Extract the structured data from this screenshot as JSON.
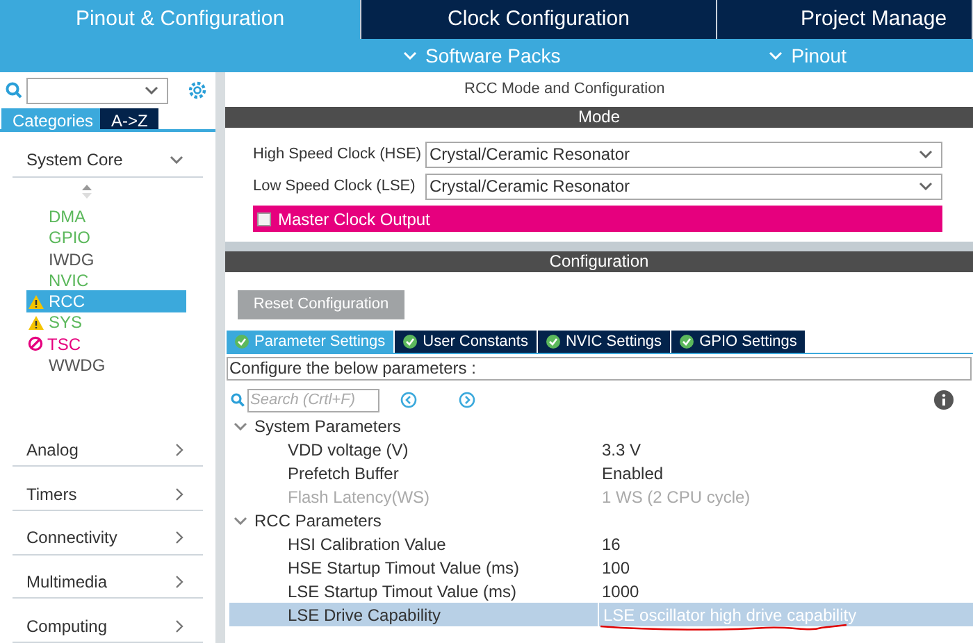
{
  "top_tabs": [
    {
      "label": "Pinout & Configuration",
      "selected": true
    },
    {
      "label": "Clock Configuration",
      "selected": false
    },
    {
      "label": "Project Manage",
      "selected": false
    }
  ],
  "sub_menu": [
    "Software Packs",
    "Pinout"
  ],
  "sidebar": {
    "view_tabs": [
      {
        "label": "Categories",
        "selected": true
      },
      {
        "label": "A->Z",
        "selected": false
      }
    ],
    "groups": [
      {
        "label": "System Core",
        "expanded": true,
        "items": [
          {
            "label": "DMA",
            "color": "#5cb85c",
            "kind": "ok",
            "selected": false
          },
          {
            "label": "GPIO",
            "color": "#5cb85c",
            "kind": "ok",
            "selected": false
          },
          {
            "label": "IWDG",
            "color": "#555555",
            "kind": "ok",
            "selected": false
          },
          {
            "label": "NVIC",
            "color": "#5cb85c",
            "kind": "ok",
            "selected": false
          },
          {
            "label": "RCC",
            "kind": "warning",
            "selected": true
          },
          {
            "label": "SYS",
            "color": "#5cb85c",
            "kind": "warning",
            "selected": false
          },
          {
            "label": "TSC",
            "color": "#e6007e",
            "kind": "error",
            "selected": false
          },
          {
            "label": "WWDG",
            "color": "#555555",
            "kind": "ok",
            "selected": false
          }
        ]
      },
      {
        "label": "Analog",
        "expanded": false
      },
      {
        "label": "Timers",
        "expanded": false
      },
      {
        "label": "Connectivity",
        "expanded": false
      },
      {
        "label": "Multimedia",
        "expanded": false
      },
      {
        "label": "Computing",
        "expanded": false
      }
    ]
  },
  "panel_title": "RCC Mode and Configuration",
  "mode": {
    "header": "Mode",
    "fields": [
      {
        "label": "High Speed Clock (HSE)",
        "value": "Crystal/Ceramic Resonator"
      },
      {
        "label": "Low Speed Clock (LSE)",
        "value": "Crystal/Ceramic Resonator"
      }
    ],
    "master_clock_output": {
      "label": "Master Clock Output",
      "checked": false
    }
  },
  "configuration": {
    "header": "Configuration",
    "reset_button": "Reset Configuration",
    "tabs": [
      {
        "label": "Parameter Settings",
        "selected": true
      },
      {
        "label": "User Constants",
        "selected": false
      },
      {
        "label": "NVIC Settings",
        "selected": false
      },
      {
        "label": "GPIO Settings",
        "selected": false
      }
    ],
    "hint": "Configure the below parameters :",
    "search": {
      "placeholder": "Search (Crtl+F)"
    },
    "parameter_groups": [
      {
        "label": "System Parameters",
        "expanded": true,
        "children": [
          {
            "name": "VDD voltage (V)",
            "value": "3.3 V",
            "disabled": false,
            "selected": false
          },
          {
            "name": "Prefetch Buffer",
            "value": "Enabled",
            "disabled": false,
            "selected": false
          },
          {
            "name": "Flash Latency(WS)",
            "value": "1 WS (2 CPU cycle)",
            "disabled": true,
            "selected": false
          }
        ]
      },
      {
        "label": "RCC Parameters",
        "expanded": true,
        "children": [
          {
            "name": "HSI Calibration Value",
            "value": "16",
            "disabled": false,
            "selected": false
          },
          {
            "name": "HSE Startup Timout Value (ms)",
            "value": "100",
            "disabled": false,
            "selected": false
          },
          {
            "name": "LSE Startup Timout Value (ms)",
            "value": "1000",
            "disabled": false,
            "selected": false
          },
          {
            "name": "LSE Drive Capability",
            "value": "LSE oscillator high drive capability",
            "disabled": false,
            "selected": true
          }
        ]
      }
    ]
  }
}
